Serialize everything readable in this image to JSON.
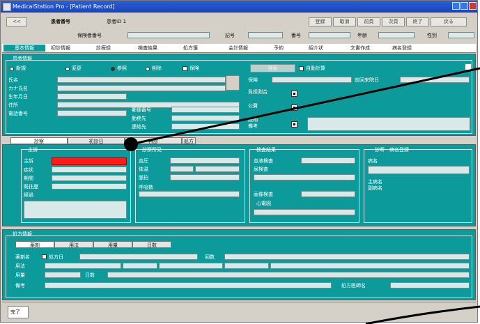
{
  "window": {
    "title": "MedicalStation Pro - [Patient Record]"
  },
  "colors": {
    "panel": "#0c9a9a",
    "titlebar": "#1a44b8",
    "highlight_field": "#ff1a1a",
    "annotation_line": "#000000"
  },
  "toolbar": {
    "back_label": "<<",
    "patient_label": "患者番号",
    "patient_value": "患者ID 1",
    "buttons": [
      "登録",
      "取消",
      "前頁",
      "次頁",
      "終了",
      "戻る"
    ]
  },
  "info_row": {
    "label_1": "保険者番号",
    "label_2": "記号",
    "label_3": "番号",
    "label_4": "年齢",
    "label_5": "性別"
  },
  "tabs": [
    "基本情報",
    "初診情報",
    "診療録",
    "検査結果",
    "処方箋",
    "会計情報",
    "予約",
    "紹介状",
    "文書作成",
    "病名登録"
  ],
  "top_panel": {
    "group_label": "患者情報",
    "radio_labels": [
      "新規",
      "変更",
      "参照",
      "削除"
    ],
    "check_label": "保険",
    "search_button": "検索",
    "right_check_label": "自動計算",
    "fields_left": [
      "氏名",
      "カナ氏名",
      "生年月日",
      "住所",
      "電話番号"
    ],
    "fields_mid": [
      "郵便番号",
      "勤務先",
      "連絡先"
    ],
    "fields_right": [
      "保険",
      "負担割合",
      "公費",
      "続柄",
      "備考"
    ],
    "far_right_label": "前回来院日"
  },
  "sub_tabs": [
    "診察",
    "初診日",
    "再診",
    "処方"
  ],
  "group_a": {
    "title": "主訴",
    "fields": [
      "主訴",
      "症状",
      "期間",
      "既往歴",
      "経過"
    ]
  },
  "group_b": {
    "title": "診察所見",
    "fields": [
      "血圧",
      "体温",
      "脈拍",
      "呼吸数"
    ]
  },
  "group_c": {
    "title": "検査結果",
    "fields": [
      "血液検査",
      "尿検査",
      "画像検査",
      "心電図"
    ]
  },
  "group_d": {
    "title": "診断・病名登録",
    "labels": [
      "病名",
      "主病名",
      "副病名"
    ]
  },
  "bottom_panel": {
    "group_label": "処方情報",
    "tabs": [
      "薬剤",
      "用法",
      "用量",
      "日数"
    ],
    "row_labels": [
      "薬剤名",
      "用法",
      "用量",
      "日数",
      "備考"
    ],
    "inline_labels": [
      "処方日",
      "回数",
      "備考",
      "処方医師名"
    ]
  },
  "status_bar": {
    "text": "完了"
  }
}
